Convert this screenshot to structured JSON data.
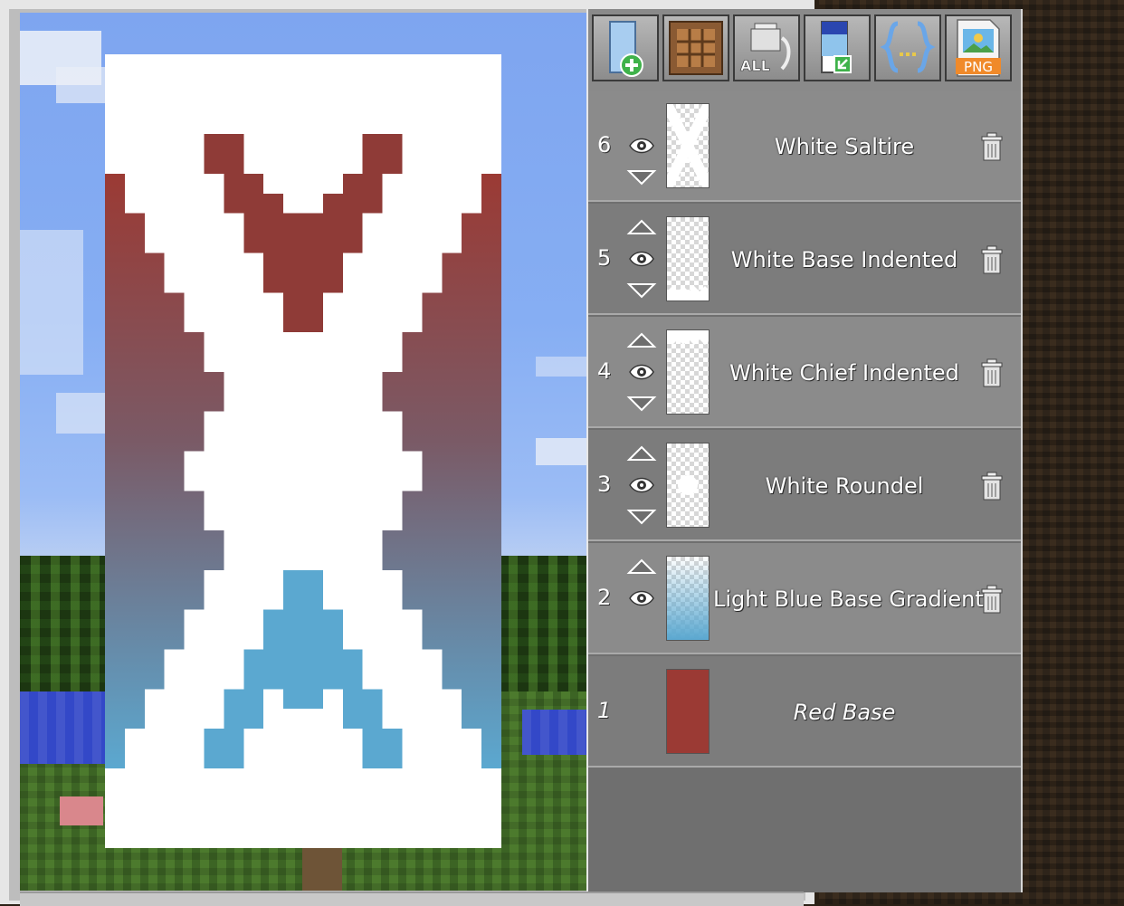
{
  "toolbar": {
    "buttons": [
      {
        "name": "add-layer-button",
        "icon": "banner-plus-icon"
      },
      {
        "name": "crafting-button",
        "icon": "crafting-table-icon"
      },
      {
        "name": "delete-all-button",
        "icon": "trash-all-icon",
        "label": "ALL"
      },
      {
        "name": "export-banner-button",
        "icon": "banner-export-icon"
      },
      {
        "name": "json-button",
        "icon": "braces-icon",
        "label": "{…}"
      },
      {
        "name": "png-button",
        "icon": "png-file-icon",
        "label": "PNG"
      }
    ]
  },
  "layers": [
    {
      "number": "6",
      "name": "White Saltire",
      "up": false,
      "down": true,
      "eye": true,
      "trash": true,
      "pattern": "saltire"
    },
    {
      "number": "5",
      "name": "White Base Indented",
      "up": true,
      "down": true,
      "eye": true,
      "trash": true,
      "pattern": "base-indented"
    },
    {
      "number": "4",
      "name": "White Chief Indented",
      "up": true,
      "down": true,
      "eye": true,
      "trash": true,
      "pattern": "chief-indented"
    },
    {
      "number": "3",
      "name": "White Roundel",
      "up": true,
      "down": true,
      "eye": true,
      "trash": true,
      "pattern": "roundel"
    },
    {
      "number": "2",
      "name": "Light Blue Base Gradient",
      "up": true,
      "down": false,
      "eye": true,
      "trash": true,
      "pattern": "gradient"
    },
    {
      "number": "1",
      "name": "Red Base",
      "up": false,
      "down": false,
      "eye": false,
      "trash": false,
      "pattern": "base"
    }
  ],
  "colors": {
    "red": "#9b3a34",
    "light_blue": "#5ba8d0",
    "white": "#ffffff",
    "panel": "#8b8b8b"
  }
}
